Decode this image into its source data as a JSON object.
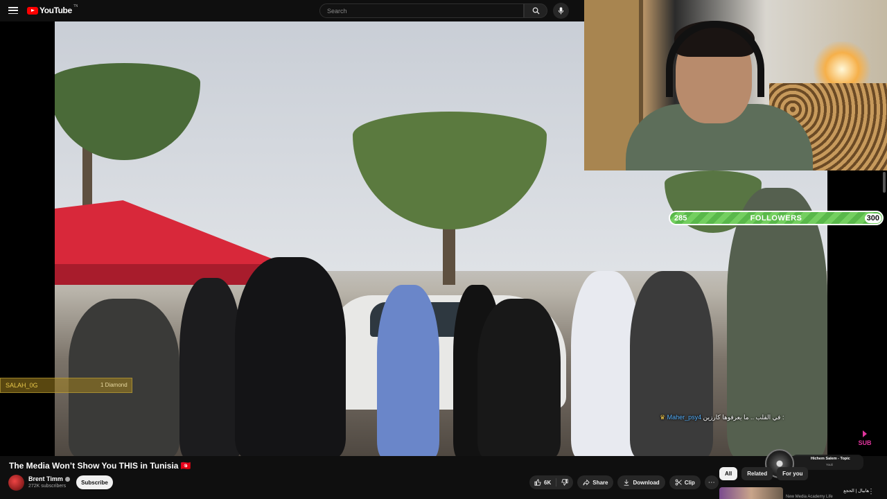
{
  "header": {
    "logo_text": "YouTube",
    "logo_country": "TN",
    "search_placeholder": "Search"
  },
  "video": {
    "title": "The Media Won’t Show You THIS in Tunisia 🇹🇳",
    "channel": {
      "name": "Brent Timm",
      "subscribers": "272K subscribers",
      "subscribe_label": "Subscribe"
    },
    "actions": {
      "likes": "6K",
      "share": "Share",
      "download": "Download",
      "clip": "Clip",
      "more": "⋯"
    }
  },
  "stream_overlay": {
    "followers": {
      "current": "285",
      "label": "FOLLOWERS",
      "goal": "300",
      "progress": 0.95
    },
    "alert": {
      "user": "SALAH_0G",
      "amount": "1 Diamond"
    },
    "chat": {
      "user": "Maher_psy4",
      "message": "في القلب .. ما يعرفوها كارزين :"
    },
    "sub_badge": "SUB",
    "now_playing": {
      "title": "Hichem Salem - Topic",
      "subtitle": "Youli"
    }
  },
  "chips": [
    "All",
    "Related",
    "For you"
  ],
  "related": [
    {
      "title": "هابيال | الحجع",
      "meta": "New Media Academy Life"
    }
  ],
  "colors": {
    "brand": "#ff0000",
    "followers_bar": "#59b84a",
    "chat_user": "#58b3ff"
  }
}
